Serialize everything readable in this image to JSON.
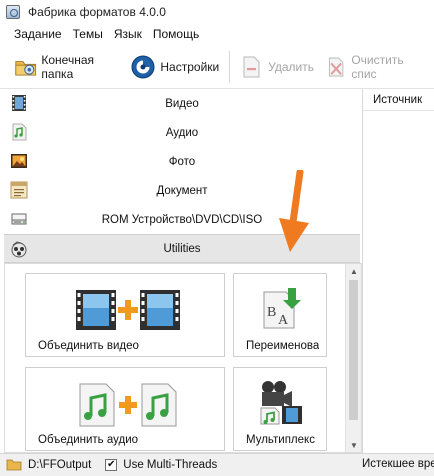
{
  "window": {
    "title": "Фабрика форматов 4.0.0"
  },
  "menu": [
    "Задание",
    "Темы",
    "Язык",
    "Помощь"
  ],
  "toolbar": {
    "output_folder_label": "Конечная папка",
    "settings_label": "Настройки",
    "delete_label": "Удалить",
    "clear_label": "Очистить спис"
  },
  "categories": [
    {
      "label": "Видео",
      "icon": "film-icon"
    },
    {
      "label": "Аудио",
      "icon": "audio-note-icon"
    },
    {
      "label": "Фото",
      "icon": "photo-icon"
    },
    {
      "label": "Документ",
      "icon": "document-icon"
    },
    {
      "label": "ROM Устройство\\DVD\\CD\\ISO",
      "icon": "rom-drive-icon"
    },
    {
      "label": "Utilities",
      "icon": "utilities-icon"
    }
  ],
  "tiles": [
    {
      "label": "Объединить видео",
      "icon": "join-video-icon"
    },
    {
      "label": "Переименова",
      "icon": "rename-icon"
    },
    {
      "label": "Объединить аудио",
      "icon": "join-audio-icon"
    },
    {
      "label": "Мультиплекс",
      "icon": "multiplex-icon"
    }
  ],
  "right_panel": {
    "header": "Источник"
  },
  "status": {
    "output_path": "D:\\FFOutput",
    "multithread_label": "Use Multi-Threads",
    "multithread_checked": "✔",
    "elapsed_label": "Истекшее время"
  },
  "colors": {
    "accent_arrow": "#f07a1f",
    "active_category_bg": "#e6e6e6",
    "statusbar_bg": "#f0f0f0"
  }
}
